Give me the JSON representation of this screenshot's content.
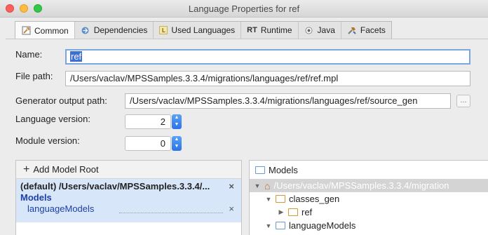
{
  "window": {
    "title": "Language Properties for ref"
  },
  "tabs": [
    {
      "label": "Common",
      "icon": "wrench-icon"
    },
    {
      "label": "Dependencies",
      "icon": "dependencies-icon"
    },
    {
      "label": "Used Languages",
      "icon": "language-icon",
      "icon_text": "L"
    },
    {
      "label": "Runtime",
      "icon": "runtime-icon",
      "icon_text": "RT"
    },
    {
      "label": "Java",
      "icon": "java-icon"
    },
    {
      "label": "Facets",
      "icon": "facets-icon"
    }
  ],
  "form": {
    "name_label": "Name:",
    "name_value": "ref",
    "file_path_label": "File path:",
    "file_path_value": "/Users/vaclav/MPSSamples.3.3.4/migrations/languages/ref/ref.mpl",
    "generator_label": "Generator output path:",
    "generator_value": "/Users/vaclav/MPSSamples.3.3.4/migrations/languages/ref/source_gen",
    "browse_label": "...",
    "language_version_label": "Language version:",
    "language_version_value": "2",
    "module_version_label": "Module version:",
    "module_version_value": "0"
  },
  "model_roots": {
    "add_label": "Add Model Root",
    "entry_path": "(default) /Users/vaclav/MPSSamples.3.3.4/...",
    "section_label": "Models",
    "item_label": "languageModels",
    "remove_icon": "×"
  },
  "tree": {
    "header": "Models",
    "root_path": "/Users/vaclav/MPSSamples.3.3.4/migration",
    "nodes": {
      "classes_gen": "classes_gen",
      "ref": "ref",
      "languageModels": "languageModels"
    }
  },
  "colors": {
    "accent": "#3e6fd3",
    "selection": "#d8e6f9",
    "focus_ring": "#7ba6e0"
  }
}
